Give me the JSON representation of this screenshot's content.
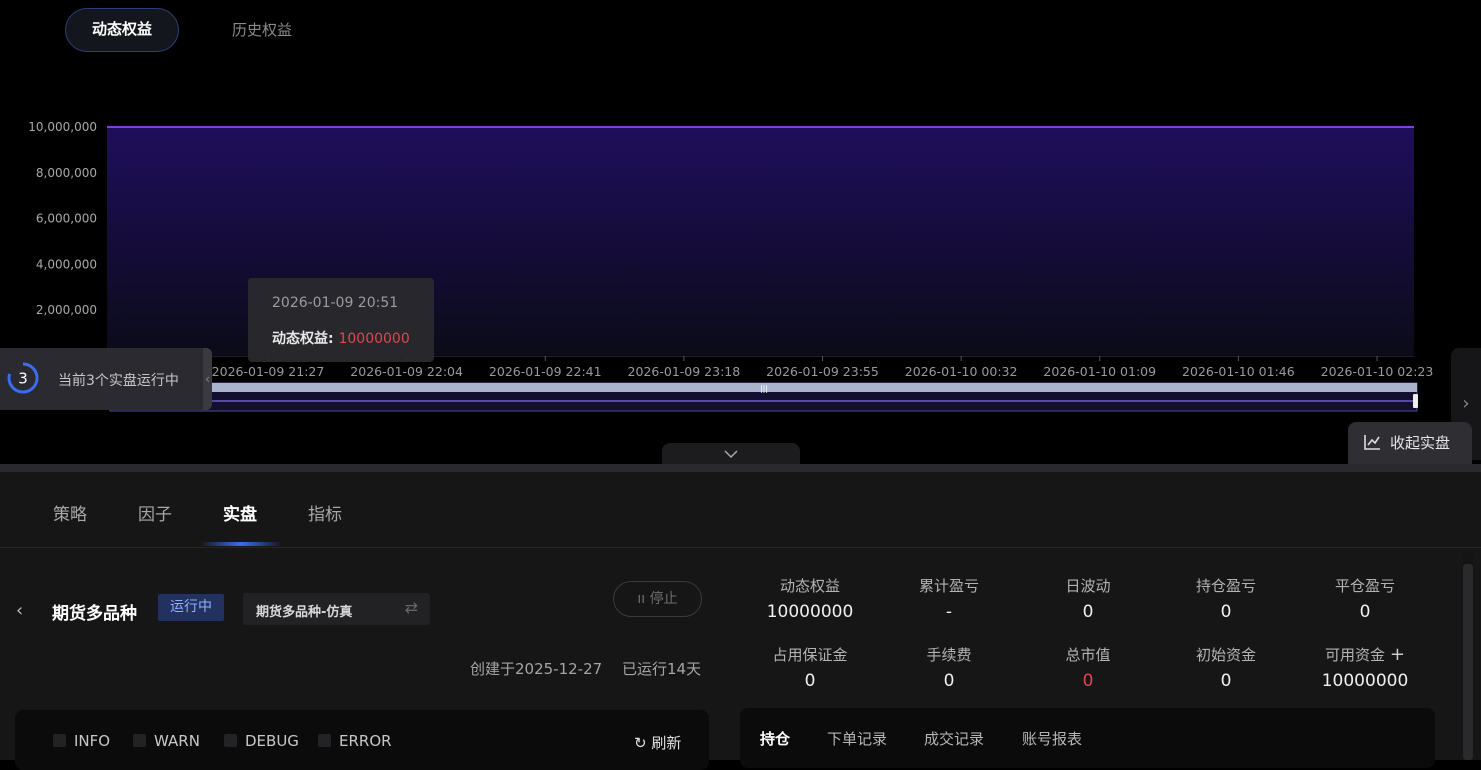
{
  "top_tabs": [
    {
      "label": "动态权益",
      "active": true
    },
    {
      "label": "历史权益",
      "active": false
    }
  ],
  "chart_data": {
    "type": "area",
    "series": [
      {
        "name": "动态权益",
        "x": [
          "2026-01-09 20:51",
          "2026-01-10 02:23"
        ],
        "values": [
          10000000,
          10000000
        ]
      }
    ],
    "x_ticks": [
      "2026-01-09 21:27",
      "2026-01-09 22:04",
      "2026-01-09 22:41",
      "2026-01-09 23:18",
      "2026-01-09 23:55",
      "2026-01-10 00:32",
      "2026-01-10 01:09",
      "2026-01-10 01:46",
      "2026-01-10 02:23"
    ],
    "y_ticks": [
      "10,000,000",
      "8,000,000",
      "6,000,000",
      "4,000,000",
      "2,000,000"
    ],
    "y_tick_values": [
      10000000,
      8000000,
      6000000,
      4000000,
      2000000
    ],
    "ylim": [
      0,
      10000000
    ],
    "line_color": "#7b3fe0",
    "fill_color": "#1e0f5a",
    "grid": true
  },
  "tooltip": {
    "date": "2026-01-09 20:51",
    "label": "动态权益:",
    "value": "10000000"
  },
  "running": {
    "count": "3",
    "text": "当前3个实盘运行中"
  },
  "collapse_label": "收起实盘",
  "nav_tabs": [
    {
      "label": "策略",
      "active": false
    },
    {
      "label": "因子",
      "active": false
    },
    {
      "label": "实盘",
      "active": true
    },
    {
      "label": "指标",
      "active": false
    }
  ],
  "strategy": {
    "name": "期货多品种",
    "status": "运行中",
    "account": "期货多品种-仿真",
    "stop_label": "停止",
    "created": "创建于2025-12-27",
    "runtime": "已运行14天"
  },
  "metrics": [
    {
      "label": "动态权益",
      "value": "10000000"
    },
    {
      "label": "累计盈亏",
      "value": "-"
    },
    {
      "label": "日波动",
      "value": "0"
    },
    {
      "label": "持仓盈亏",
      "value": "0"
    },
    {
      "label": "平仓盈亏",
      "value": "0"
    },
    {
      "label": "占用保证金",
      "value": "0"
    },
    {
      "label": "手续费",
      "value": "0"
    },
    {
      "label": "总市值",
      "value": "0",
      "red": true
    },
    {
      "label": "初始资金",
      "value": "0"
    },
    {
      "label": "可用资金",
      "value": "10000000"
    }
  ],
  "log_filters": [
    "INFO",
    "WARN",
    "DEBUG",
    "ERROR"
  ],
  "refresh_label": "刷新",
  "position_tabs": [
    {
      "label": "持仓",
      "active": true
    },
    {
      "label": "下单记录",
      "active": false
    },
    {
      "label": "成交记录",
      "active": false
    },
    {
      "label": "账号报表",
      "active": false
    }
  ],
  "colors": {
    "accent": "#3a6cf0",
    "red": "#e0474c",
    "badge_bg": "#23315e"
  }
}
